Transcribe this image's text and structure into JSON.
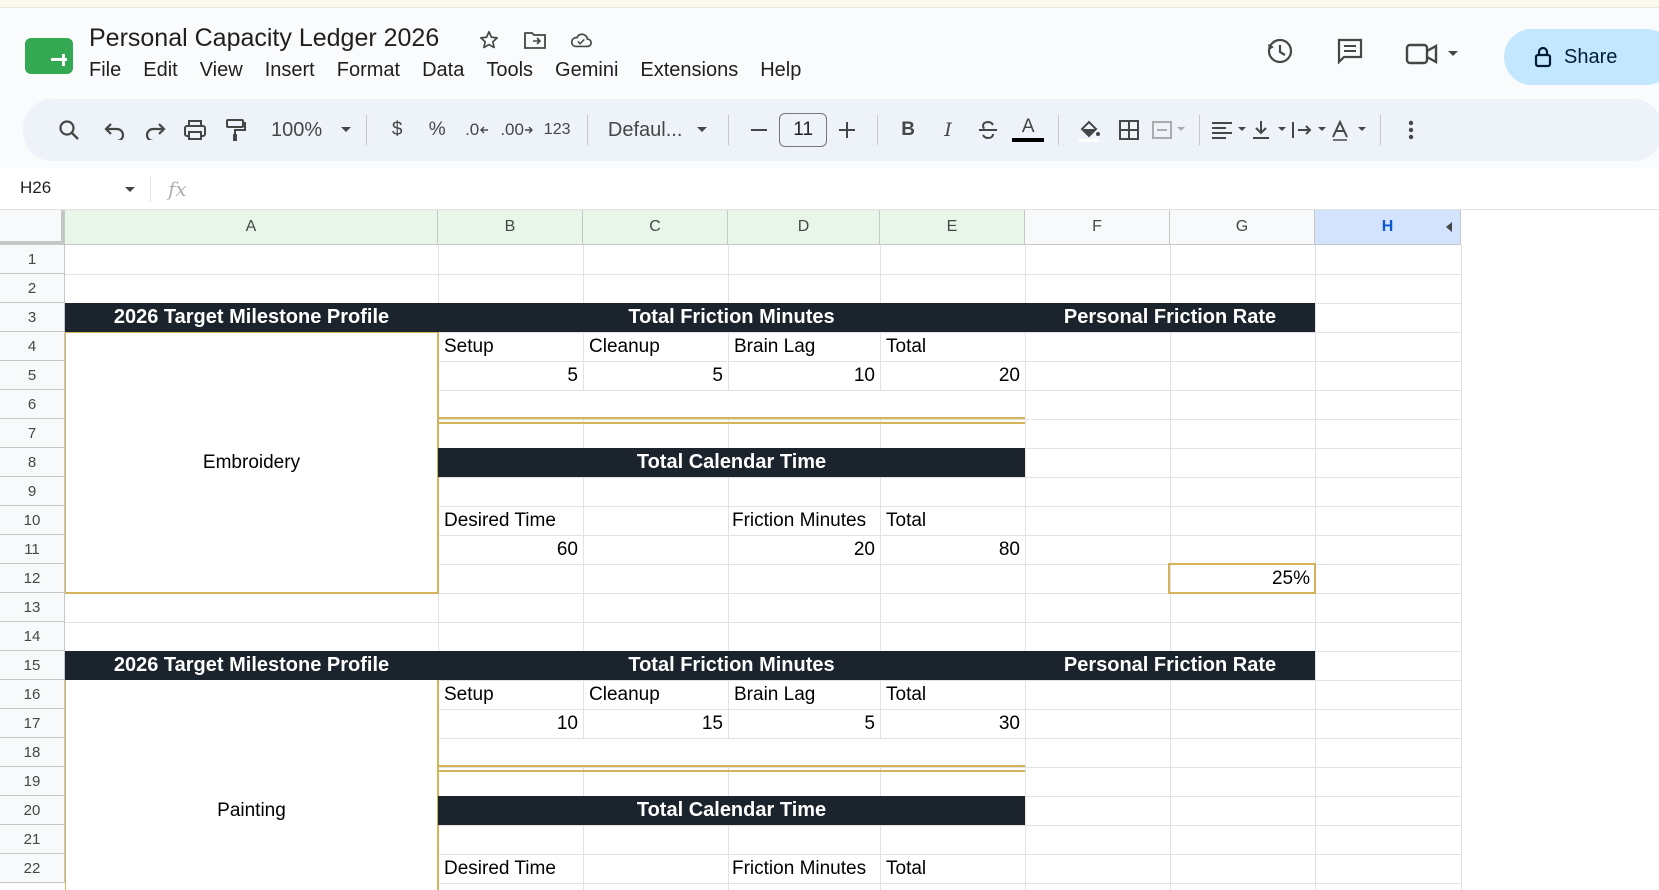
{
  "document": {
    "title": "Personal Capacity Ledger 2026"
  },
  "menu": [
    "File",
    "Edit",
    "View",
    "Insert",
    "Format",
    "Data",
    "Tools",
    "Gemini",
    "Extensions",
    "Help"
  ],
  "share": {
    "label": "Share"
  },
  "toolbar": {
    "zoom": "100%",
    "currency": "$",
    "percent": "%",
    "dec_decrease": ".0",
    "dec_increase": ".00",
    "number_format": "123",
    "font": "Defaul...",
    "font_size": "11",
    "minus": "–",
    "plus": "+",
    "bold": "B",
    "italic": "I",
    "text_color": "A"
  },
  "formula_bar": {
    "name_box": "H26",
    "fx": "fx",
    "value": ""
  },
  "columns": [
    "A",
    "B",
    "C",
    "D",
    "E",
    "F",
    "G",
    "H"
  ],
  "rows": [
    "1",
    "2",
    "3",
    "4",
    "5",
    "6",
    "7",
    "8",
    "9",
    "10",
    "11",
    "12",
    "13",
    "14",
    "15",
    "16",
    "17",
    "18",
    "19",
    "20",
    "21",
    "22"
  ],
  "blocks": [
    {
      "profile_header": "2026 Target Milestone Profile",
      "friction_header": "Total Friction Minutes",
      "rate_header": "Personal Friction Rate",
      "activity": "Embroidery",
      "friction_labels": {
        "setup": "Setup",
        "cleanup": "Cleanup",
        "brain_lag": "Brain Lag",
        "total": "Total"
      },
      "friction_values": {
        "setup": "5",
        "cleanup": "5",
        "brain_lag": "10",
        "total": "20"
      },
      "calendar_header": "Total Calendar Time",
      "calendar_labels": {
        "desired": "Desired Time",
        "friction": "Friction Minutes",
        "total": "Total"
      },
      "calendar_values": {
        "desired": "60",
        "friction": "20",
        "total": "80"
      },
      "rate_value": "25%"
    },
    {
      "profile_header": "2026 Target Milestone Profile",
      "friction_header": "Total Friction Minutes",
      "rate_header": "Personal Friction Rate",
      "activity": "Painting",
      "friction_labels": {
        "setup": "Setup",
        "cleanup": "Cleanup",
        "brain_lag": "Brain Lag",
        "total": "Total"
      },
      "friction_values": {
        "setup": "10",
        "cleanup": "15",
        "brain_lag": "5",
        "total": "30"
      },
      "calendar_header": "Total Calendar Time",
      "calendar_labels": {
        "desired": "Desired Time",
        "friction": "Friction Minutes",
        "total": "Total"
      }
    }
  ],
  "colors": {
    "header_dark": "#1b232c",
    "accent_gold": "#d4b35a",
    "share_bg": "#c2e7ff",
    "selected_col": "#d3e3fd"
  }
}
